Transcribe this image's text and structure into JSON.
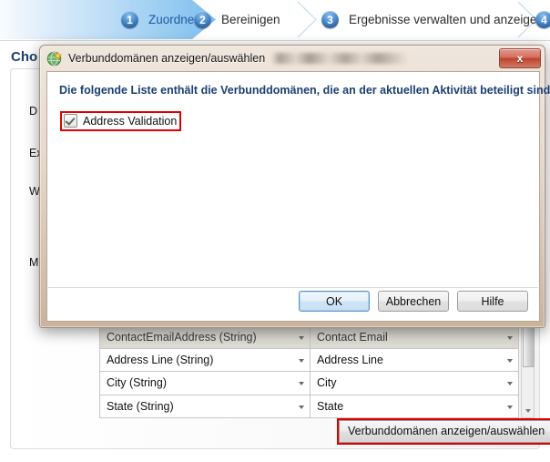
{
  "wizard": {
    "steps": [
      {
        "num": "1",
        "label": "Zuordnen",
        "active": true
      },
      {
        "num": "2",
        "label": "Bereinigen",
        "active": false
      },
      {
        "num": "3",
        "label": "Ergebnisse verwalten und anzeigen",
        "active": false
      },
      {
        "num": "4",
        "label": "",
        "active": false
      }
    ]
  },
  "page": {
    "title": "Cho",
    "side_labels": [
      "D",
      "Ex",
      "W",
      "M"
    ]
  },
  "mapping_table": {
    "rows": [
      {
        "source": "ContactEmailAddress (String)",
        "target": "Contact Email",
        "dim": true
      },
      {
        "source": "Address Line (String)",
        "target": "Address Line",
        "dim": false
      },
      {
        "source": "City (String)",
        "target": "City",
        "dim": false
      },
      {
        "source": "State (String)",
        "target": "State",
        "dim": false
      }
    ]
  },
  "bottom_button": {
    "label": "Verbunddomänen anzeigen/auswählen"
  },
  "dialog": {
    "title": "Verbunddomänen anzeigen/auswählen",
    "close_label": "x",
    "message": "Die folgende Liste enthält die Verbunddomänen, die an der aktuellen Aktivität beteiligt sind.",
    "checkbox": {
      "label": "Address Validation",
      "checked": true
    },
    "buttons": [
      {
        "label": "OK",
        "default": true
      },
      {
        "label": "Abbrechen",
        "default": false
      },
      {
        "label": "Hilfe",
        "default": false
      }
    ]
  },
  "colors": {
    "highlight_red": "#e00000",
    "heading_blue": "#1d3f73",
    "step_active_blue": "#1d5ba0",
    "dialog_frame": "#d8c6b4"
  }
}
